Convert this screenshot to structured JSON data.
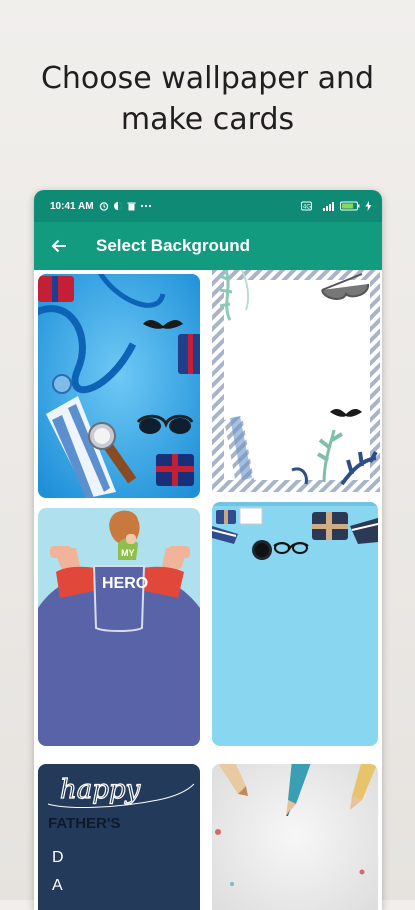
{
  "headline": {
    "line1": "Choose wallpaper and",
    "line2": "make cards"
  },
  "statusbar": {
    "time": "10:41 AM",
    "icons": [
      "alarm-icon",
      "vpn-icon",
      "trash-icon",
      "more-dots-icon"
    ],
    "right_icons": [
      "data-saver-icon",
      "signal-icon",
      "battery-icon",
      "charging-icon"
    ]
  },
  "toolbar": {
    "back_icon": "arrow-left-icon",
    "title": "Select Background"
  },
  "colors": {
    "status_bar": "#0f8a74",
    "toolbar": "#139b80"
  },
  "wallpapers": [
    {
      "theme": "blue-ribbon-tie-watch"
    },
    {
      "theme": "striped-frame-leaves"
    },
    {
      "theme": "my-hero-dad",
      "text": "MY",
      "text2": "HERO"
    },
    {
      "theme": "sky-blue-gifts"
    },
    {
      "theme": "happy-fathers-day",
      "text": "happy",
      "text2": "FATHER'S",
      "letters": [
        "D",
        "A"
      ]
    },
    {
      "theme": "colored-pencils"
    }
  ]
}
